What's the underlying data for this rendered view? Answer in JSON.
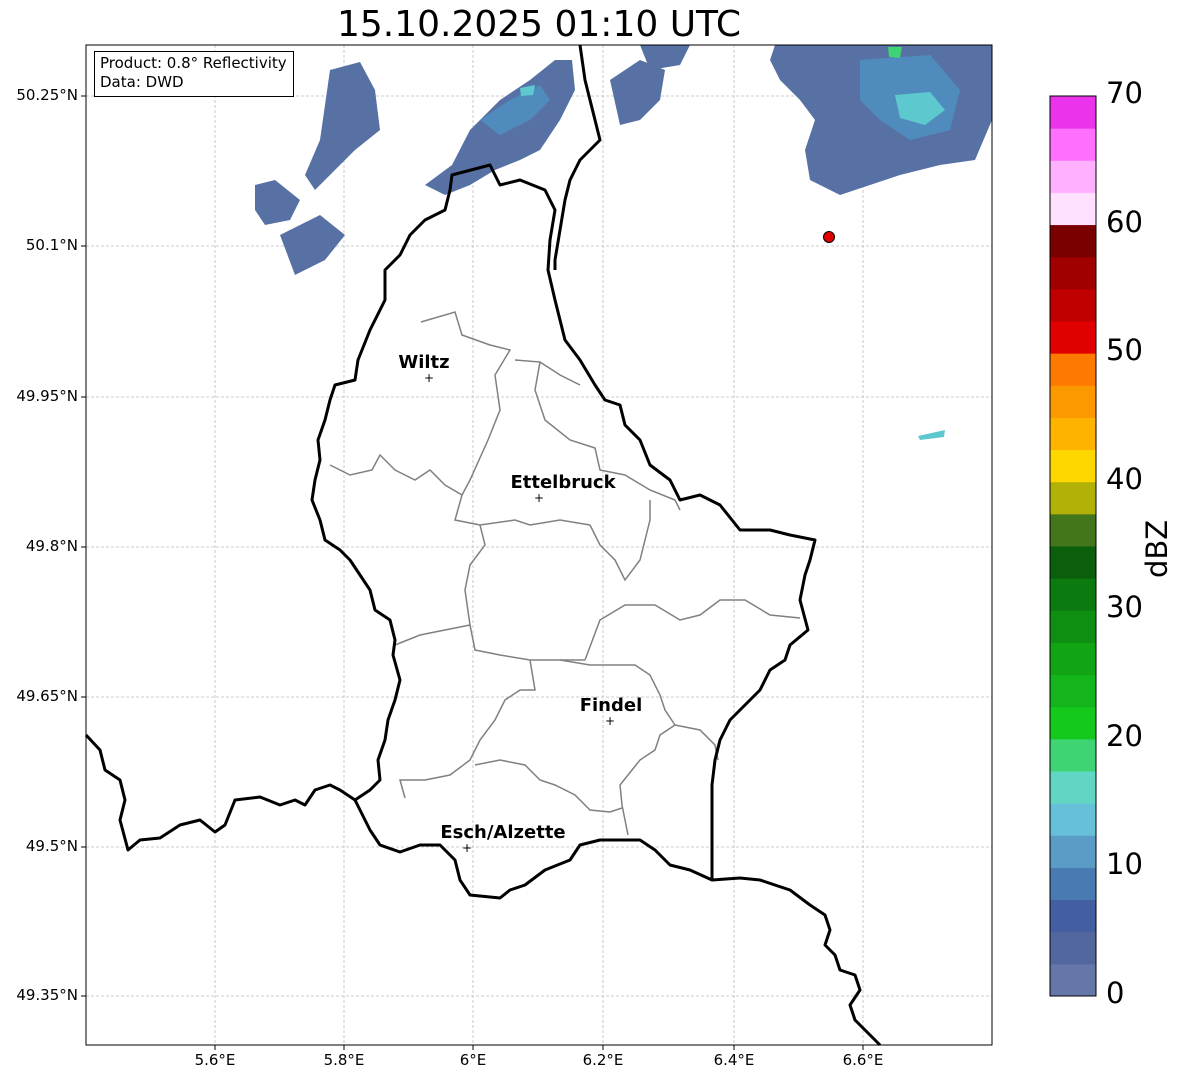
{
  "title": "15.10.2025 01:10 UTC",
  "info": {
    "product": "Product: 0.8° Reflectivity",
    "source": "Data: DWD"
  },
  "axes": {
    "lat_ticks": [
      "50.25°N",
      "50.1°N",
      "49.95°N",
      "49.8°N",
      "49.65°N",
      "49.5°N",
      "49.35°N"
    ],
    "lon_ticks": [
      "5.6°E",
      "5.8°E",
      "6°E",
      "6.2°E",
      "6.4°E",
      "6.6°E"
    ]
  },
  "cities": [
    {
      "name": "Wiltz",
      "lon": 5.93,
      "lat": 49.97
    },
    {
      "name": "Ettelbruck",
      "lon": 6.1,
      "lat": 49.85
    },
    {
      "name": "Findel",
      "lon": 6.21,
      "lat": 49.627
    },
    {
      "name": "Esch/Alzette",
      "lon": 5.99,
      "lat": 49.5
    }
  ],
  "radar_site": {
    "lon": 6.547,
    "lat": 50.111,
    "color": "#e00000"
  },
  "colorbar": {
    "label": "dBZ",
    "ticks": [
      "0",
      "10",
      "20",
      "30",
      "40",
      "50",
      "60",
      "70"
    ],
    "colors": [
      "#6477a8",
      "#52679e",
      "#435ea1",
      "#4a7ab2",
      "#5a9cc5",
      "#66c0d8",
      "#62d6c4",
      "#3ed473",
      "#14c81c",
      "#13b51a",
      "#11a414",
      "#0f8f12",
      "#0b7a0f",
      "#0a5e0c",
      "#43761a",
      "#b1b107",
      "#fed600",
      "#fdb300",
      "#fd9900",
      "#fd7a00",
      "#e10000",
      "#c00000",
      "#a00000",
      "#7a0000",
      "#ffe0ff",
      "#ffb0ff",
      "#ff70ff",
      "#ea33ea"
    ]
  }
}
